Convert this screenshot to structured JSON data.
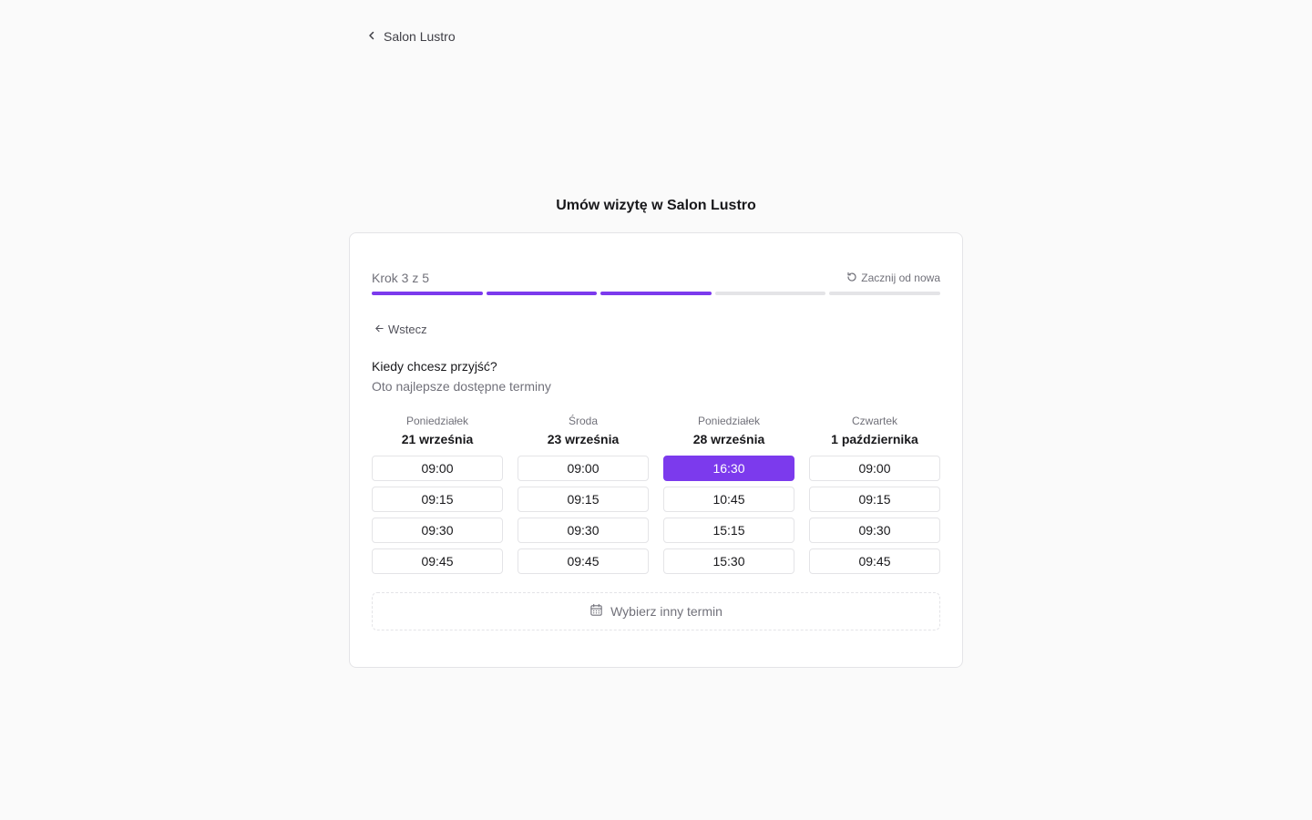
{
  "header": {
    "back_label": "Salon Lustro",
    "back_icon": "chevron-left-icon"
  },
  "page_title": "Umów wizytę w Salon Lustro",
  "wizard": {
    "step_label": "Krok 3 z 5",
    "restart_label": "Zacznij od nowa",
    "restart_icon": "refresh-icon",
    "steps_total": 5,
    "steps_completed": 3,
    "accent_color": "#7c3aed",
    "back_label": "Wstecz",
    "back_icon": "arrow-left-icon"
  },
  "question": {
    "title": "Kiedy chcesz przyjść?",
    "subtitle": "Oto najlepsze dostępne terminy"
  },
  "days": [
    {
      "weekday": "Poniedziałek",
      "date": "21 września",
      "slots": [
        "09:00",
        "09:15",
        "09:30",
        "09:45"
      ],
      "selected": null
    },
    {
      "weekday": "Środa",
      "date": "23 września",
      "slots": [
        "09:00",
        "09:15",
        "09:30",
        "09:45"
      ],
      "selected": null
    },
    {
      "weekday": "Poniedziałek",
      "date": "28 września",
      "slots": [
        "16:30",
        "10:45",
        "15:15",
        "15:30"
      ],
      "selected": 0
    },
    {
      "weekday": "Czwartek",
      "date": "1 października",
      "slots": [
        "09:00",
        "09:15",
        "09:30",
        "09:45"
      ],
      "selected": null
    }
  ],
  "other_date": {
    "label": "Wybierz inny termin",
    "icon": "calendar-icon"
  }
}
